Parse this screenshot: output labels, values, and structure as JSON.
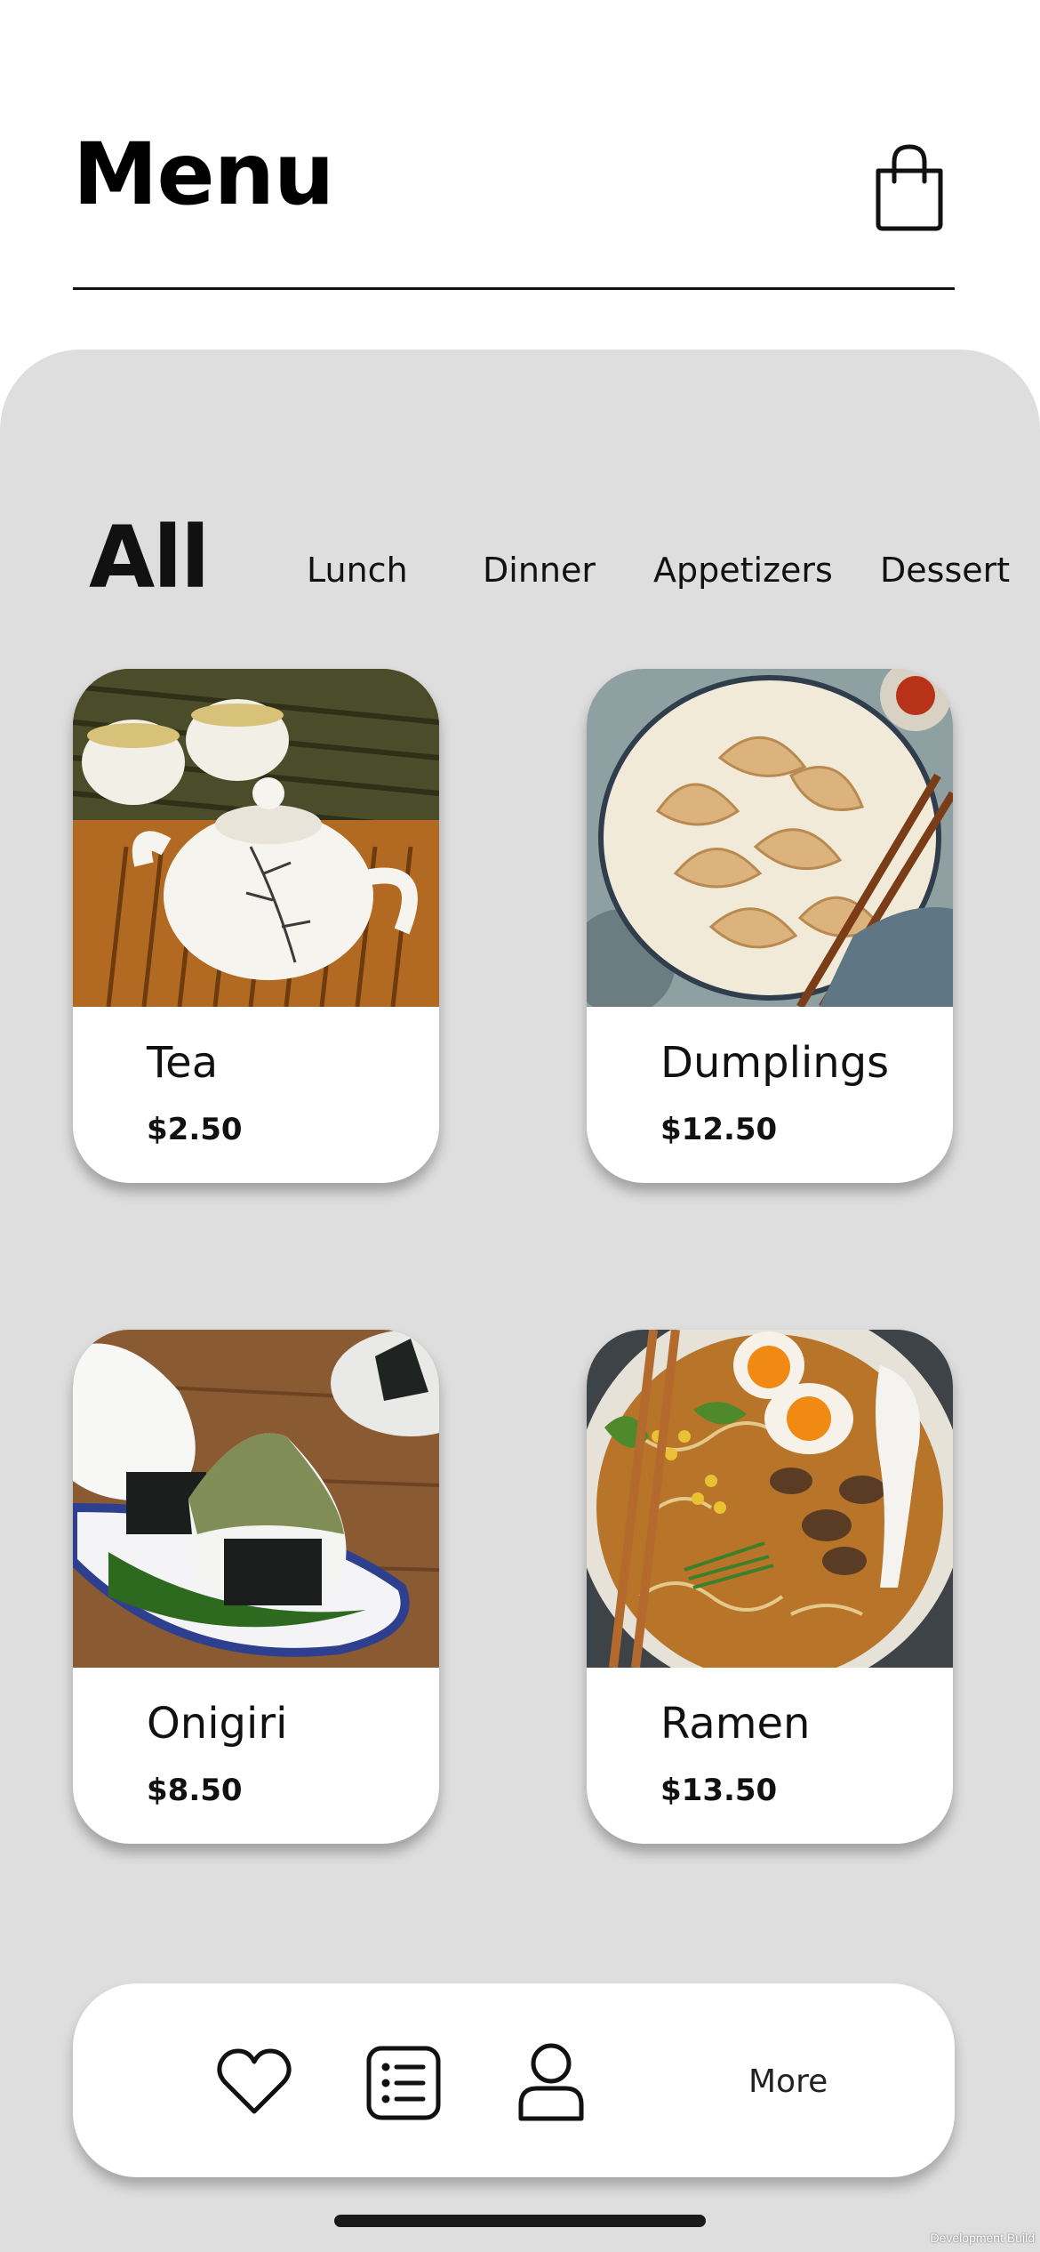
{
  "header": {
    "title": "Menu",
    "cart_icon": "shopping-bag-icon"
  },
  "categories": [
    {
      "label": "All",
      "active": true
    },
    {
      "label": "Lunch",
      "active": false
    },
    {
      "label": "Dinner",
      "active": false
    },
    {
      "label": "Appetizers",
      "active": false
    },
    {
      "label": "Dessert",
      "active": false
    }
  ],
  "items": [
    {
      "name": "Tea",
      "price": "$2.50",
      "image": "teapot-with-cups-photo"
    },
    {
      "name": "Dumplings",
      "price": "$12.50",
      "image": "dumplings-plate-photo"
    },
    {
      "name": "Onigiri",
      "price": "$8.50",
      "image": "onigiri-rice-balls-photo"
    },
    {
      "name": "Ramen",
      "price": "$13.50",
      "image": "ramen-bowl-photo"
    }
  ],
  "bottom_nav": {
    "icons": [
      "heart-icon",
      "list-icon",
      "user-icon"
    ],
    "more_label": "More"
  },
  "footer": {
    "dev_label": "Development Build"
  },
  "colors": {
    "panel": "#dedede",
    "card": "#ffffff",
    "text": "#111111"
  }
}
